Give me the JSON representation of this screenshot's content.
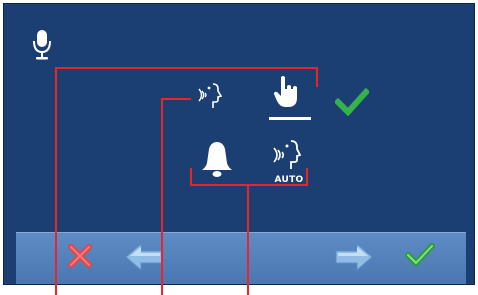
{
  "screen": {
    "auto_label": "AUTO"
  },
  "icons": {
    "microphone": "microphone-icon",
    "voice_small": "voice-activation-icon",
    "touch": "touch-hand-icon",
    "confirm_mark": "checkmark-icon",
    "bell": "bell-icon",
    "voice_auto": "voice-auto-icon",
    "cancel": "cross-icon",
    "prev": "arrow-left-icon",
    "next": "arrow-right-icon",
    "confirm": "checkmark-icon"
  },
  "colors": {
    "screen_bg": "#1b3f72",
    "bar_bg": "#5e8bc4",
    "check_green": "#34b34a",
    "cancel_red": "#e0484a",
    "arrow_blue": "#8fbde6",
    "leader_red": "#e8262a"
  }
}
